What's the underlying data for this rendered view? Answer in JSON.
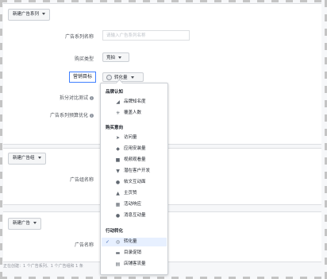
{
  "campaign": {
    "new_button": "新建广告系列",
    "name_label": "广告系列名称",
    "name_placeholder": "请输入广告系列名称",
    "buy_type_label": "购买类型",
    "buy_type_value": "竞拍",
    "goal_label": "营销目标",
    "goal_value": "转化量",
    "split_test_label": "拆分对比测试",
    "budget_opt_label": "广告系列预算优化"
  },
  "adset": {
    "new_button": "新建广告组",
    "name_label": "广告组名称"
  },
  "ad": {
    "new_button": "新建广告",
    "name_label": "广告名称"
  },
  "footer_text": "正在创建：1 个广告系列、1 个广告组和 1 条",
  "dropdown": {
    "groups": [
      {
        "title": "品牌认知",
        "items": [
          {
            "label": "品牌知名度",
            "icon": "megaphone-icon"
          },
          {
            "label": "覆盖人数",
            "icon": "reach-icon"
          }
        ]
      },
      {
        "title": "购买意向",
        "items": [
          {
            "label": "访问量",
            "icon": "cursor-icon"
          },
          {
            "label": "应用安装量",
            "icon": "box-icon"
          },
          {
            "label": "视频观看量",
            "icon": "video-icon"
          },
          {
            "label": "潜在客户开发",
            "icon": "funnel-icon"
          },
          {
            "label": "帖文互动面",
            "icon": "people-icon"
          },
          {
            "label": "主页赞",
            "icon": "thumbs-up-icon"
          },
          {
            "label": "活动响应",
            "icon": "calendar-icon"
          },
          {
            "label": "消息互动量",
            "icon": "chat-icon"
          }
        ]
      },
      {
        "title": "行动转化",
        "items": [
          {
            "label": "转化量",
            "icon": "globe-icon",
            "selected": true
          },
          {
            "label": "目录促销",
            "icon": "cart-icon"
          },
          {
            "label": "店铺客流量",
            "icon": "store-icon"
          }
        ]
      }
    ]
  }
}
